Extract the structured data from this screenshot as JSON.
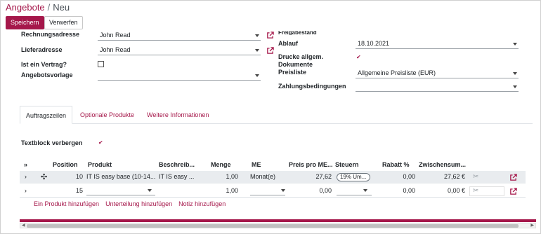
{
  "header": {
    "breadcrumb_root": "Angebote",
    "breadcrumb_sep": "/",
    "breadcrumb_current": "Neu",
    "save_label": "Speichern",
    "discard_label": "Verwerfen"
  },
  "form": {
    "rechnungsadresse": {
      "label": "Rechnungsadresse",
      "value": "John Read"
    },
    "lieferadresse": {
      "label": "Lieferadresse",
      "value": "John Read"
    },
    "vertrag": {
      "label": "Ist ein Vertrag?",
      "checked": false
    },
    "angebotsvorlage": {
      "label": "Angebotsvorlage",
      "value": ""
    },
    "freigabestand": {
      "label": "Freigabestand"
    },
    "ablauf": {
      "label": "Ablauf",
      "value": "18.10.2021"
    },
    "drucke": {
      "label_line1": "Drucke allgem.",
      "label_line2": "Dokumente",
      "checked": true
    },
    "preisliste": {
      "label": "Preisliste",
      "value": "Allgemeine Preisliste (EUR)"
    },
    "zahlungsbedingungen": {
      "label": "Zahlungsbedingungen",
      "value": ""
    }
  },
  "tabs": [
    {
      "label": "Auftragszeilen",
      "active": true
    },
    {
      "label": "Optionale Produkte",
      "active": false
    },
    {
      "label": "Weitere Informationen",
      "active": false
    }
  ],
  "textblock": {
    "label": "Textblock verbergen",
    "checked": true
  },
  "table": {
    "columns": {
      "expand": "»",
      "position": "Position",
      "produkt": "Produkt",
      "beschreibung": "Beschreib...",
      "menge": "Menge",
      "me": "ME",
      "preis": "Preis pro ME...",
      "steuern": "Steuern",
      "rabatt": "Rabatt %",
      "zwischensumme": "Zwischensum..."
    },
    "rows": [
      {
        "expand": "›",
        "position": "10",
        "produkt": "IT IS easy base (10-14...",
        "beschreibung": "IT IS easy ...",
        "menge": "1,00",
        "me": "Monat(e)",
        "preis": "27,62",
        "steuern": "19% Um...",
        "rabatt": "0,00",
        "zwischensumme": "27,62 €"
      },
      {
        "expand": "›",
        "position": "15",
        "produkt": "",
        "beschreibung": "",
        "menge": "1,00",
        "me": "",
        "preis": "0,00",
        "steuern": "",
        "rabatt": "0,00",
        "zwischensumme": "0,00 €"
      }
    ],
    "add_links": [
      "Ein Produkt hinzufügen",
      "Unterteilung hinzufügen",
      "Notiz hinzufügen"
    ]
  },
  "colors": {
    "accent": "#a5174a"
  }
}
